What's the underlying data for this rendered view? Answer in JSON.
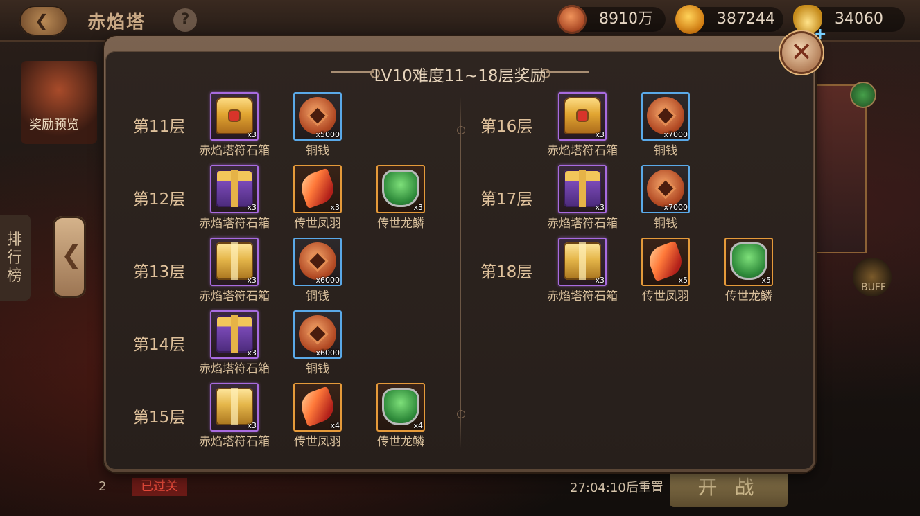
{
  "header": {
    "title": "赤焰塔",
    "help": "?",
    "copper": "8910万",
    "gold": "387244",
    "ingot": "34060"
  },
  "background": {
    "reward_preview_label": "奖励预览",
    "ranking_label": "排行榜",
    "buff_label": "BUFF",
    "reset_text": "27:04:10后重置",
    "start_button": "开 战",
    "passed_tag": "已过关",
    "row_number": "2"
  },
  "modal": {
    "title": "LV10难度11~18层奖励",
    "close": "✕",
    "left_floors": [
      {
        "label": "第11层",
        "items": [
          {
            "name": "赤焰塔符石箱",
            "qty": "x3",
            "icon": "chest-icon",
            "rarity": "purple",
            "art": "chest"
          },
          {
            "name": "铜钱",
            "qty": "x5000",
            "icon": "copper-coin-icon",
            "rarity": "blue",
            "art": "coin"
          }
        ]
      },
      {
        "label": "第12层",
        "items": [
          {
            "name": "赤焰塔符石箱",
            "qty": "x3",
            "icon": "gift-box-icon",
            "rarity": "purple",
            "art": "giftbox"
          },
          {
            "name": "传世凤羽",
            "qty": "x3",
            "icon": "phoenix-feather-icon",
            "rarity": "orange",
            "art": "feather"
          },
          {
            "name": "传世龙鳞",
            "qty": "x3",
            "icon": "dragon-scale-icon",
            "rarity": "orange",
            "art": "scale"
          }
        ]
      },
      {
        "label": "第13层",
        "items": [
          {
            "name": "赤焰塔符石箱",
            "qty": "x3",
            "icon": "gold-box-icon",
            "rarity": "purple",
            "art": "goldbox"
          },
          {
            "name": "铜钱",
            "qty": "x6000",
            "icon": "copper-coin-icon",
            "rarity": "blue",
            "art": "coin"
          }
        ]
      },
      {
        "label": "第14层",
        "items": [
          {
            "name": "赤焰塔符石箱",
            "qty": "x3",
            "icon": "gift-box-icon",
            "rarity": "purple",
            "art": "giftbox"
          },
          {
            "name": "铜钱",
            "qty": "x6000",
            "icon": "copper-coin-icon",
            "rarity": "blue",
            "art": "coin"
          }
        ]
      },
      {
        "label": "第15层",
        "items": [
          {
            "name": "赤焰塔符石箱",
            "qty": "x3",
            "icon": "gold-box-icon",
            "rarity": "purple",
            "art": "goldbox"
          },
          {
            "name": "传世凤羽",
            "qty": "x4",
            "icon": "phoenix-feather-icon",
            "rarity": "orange",
            "art": "feather"
          },
          {
            "name": "传世龙鳞",
            "qty": "x4",
            "icon": "dragon-scale-icon",
            "rarity": "orange",
            "art": "scale"
          }
        ]
      }
    ],
    "right_floors": [
      {
        "label": "第16层",
        "items": [
          {
            "name": "赤焰塔符石箱",
            "qty": "x3",
            "icon": "chest-icon",
            "rarity": "purple",
            "art": "chest"
          },
          {
            "name": "铜钱",
            "qty": "x7000",
            "icon": "copper-coin-icon",
            "rarity": "blue",
            "art": "coin"
          }
        ]
      },
      {
        "label": "第17层",
        "items": [
          {
            "name": "赤焰塔符石箱",
            "qty": "x3",
            "icon": "gift-box-icon",
            "rarity": "purple",
            "art": "giftbox"
          },
          {
            "name": "铜钱",
            "qty": "x7000",
            "icon": "copper-coin-icon",
            "rarity": "blue",
            "art": "coin"
          }
        ]
      },
      {
        "label": "第18层",
        "items": [
          {
            "name": "赤焰塔符石箱",
            "qty": "x3",
            "icon": "gold-box-icon",
            "rarity": "purple",
            "art": "goldbox"
          },
          {
            "name": "传世凤羽",
            "qty": "x5",
            "icon": "phoenix-feather-icon",
            "rarity": "orange",
            "art": "feather"
          },
          {
            "name": "传世龙鳞",
            "qty": "x5",
            "icon": "dragon-scale-icon",
            "rarity": "orange",
            "art": "scale"
          }
        ]
      }
    ]
  }
}
